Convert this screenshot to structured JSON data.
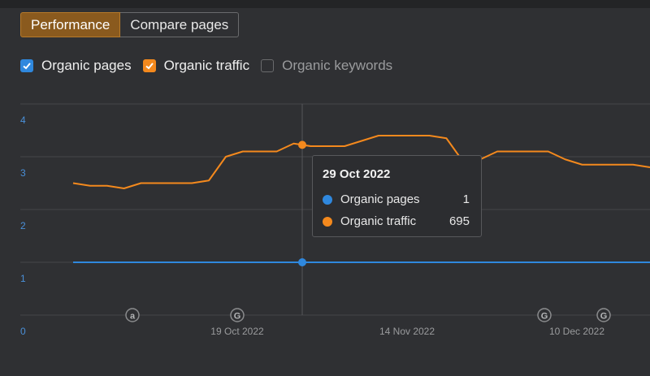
{
  "tabs": [
    {
      "label": "Performance",
      "active": true
    },
    {
      "label": "Compare pages",
      "active": false
    }
  ],
  "toggles": [
    {
      "label": "Organic pages",
      "checked": true,
      "color": "#2f88de"
    },
    {
      "label": "Organic traffic",
      "checked": true,
      "color": "#f4891d"
    },
    {
      "label": "Organic keywords",
      "checked": false,
      "color": "#6a6b6d"
    }
  ],
  "tooltip": {
    "date": "29 Oct 2022",
    "rows": [
      {
        "name": "Organic pages",
        "value": "1",
        "color": "#2f88de"
      },
      {
        "name": "Organic traffic",
        "value": "695",
        "color": "#f4891d"
      }
    ]
  },
  "event_icons": [
    {
      "glyph": "a",
      "name": "ahrefs-update-icon"
    },
    {
      "glyph": "G",
      "name": "google-update-icon"
    },
    {
      "glyph": "G",
      "name": "google-update-icon"
    },
    {
      "glyph": "G",
      "name": "google-update-icon"
    }
  ],
  "chart_data": {
    "type": "line",
    "title": "",
    "xlabel": "",
    "ylabel": "",
    "ylim": [
      0,
      4
    ],
    "y_ticks": [
      "0",
      "1",
      "2",
      "3",
      "4"
    ],
    "x_ticks": [
      "19 Oct 2022",
      "14 Nov 2022",
      "10 Dec 2022"
    ],
    "grid": true,
    "series": [
      {
        "name": "Organic pages",
        "color": "#2f88de",
        "values": [
          1,
          1,
          1,
          1,
          1,
          1,
          1,
          1,
          1,
          1,
          1,
          1,
          1,
          1,
          1,
          1,
          1
        ]
      },
      {
        "name": "Organic traffic",
        "color": "#f4891d",
        "values": [
          2.5,
          2.45,
          2.45,
          2.4,
          2.5,
          2.5,
          2.5,
          2.5,
          2.55,
          3.0,
          3.1,
          3.1,
          3.1,
          3.25,
          3.2,
          3.2,
          3.2,
          3.3,
          3.4,
          3.4,
          3.4,
          3.4,
          3.35,
          2.9,
          2.95,
          3.1,
          3.1,
          3.1,
          3.1,
          2.95,
          2.85,
          2.85,
          2.85,
          2.85,
          2.8
        ]
      }
    ]
  }
}
